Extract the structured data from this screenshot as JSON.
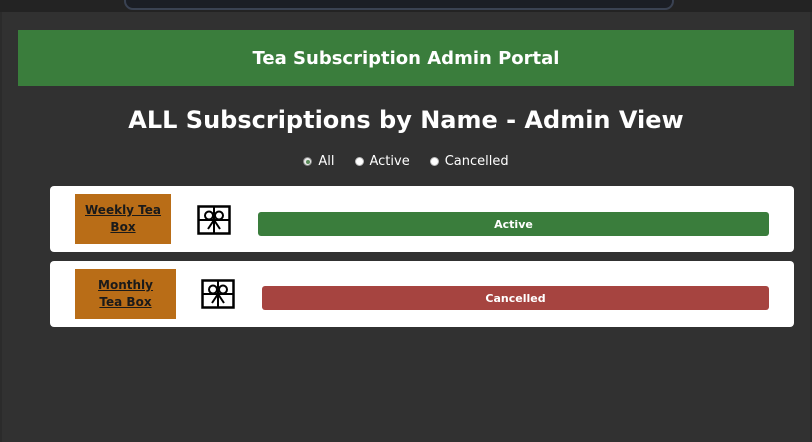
{
  "header": {
    "title": "Tea Subscription Admin Portal"
  },
  "page": {
    "title": "ALL Subscriptions by Name - Admin View"
  },
  "filters": {
    "selected": "All",
    "options": [
      {
        "label": "All",
        "checked": true
      },
      {
        "label": "Active",
        "checked": false
      },
      {
        "label": "Cancelled",
        "checked": false
      }
    ]
  },
  "subscriptions": [
    {
      "name": "Weekly Tea Box",
      "icon": "gift-icon",
      "status": "Active",
      "status_color": "#3a7d3c"
    },
    {
      "name": "Monthly Tea Box",
      "icon": "gift-icon",
      "status": "Cancelled",
      "status_color": "#a64440"
    }
  ],
  "colors": {
    "background": "#313131",
    "header": "#3a7d3c",
    "name_box": "#b96d17",
    "active": "#3a7d3c",
    "cancelled": "#a64440"
  }
}
